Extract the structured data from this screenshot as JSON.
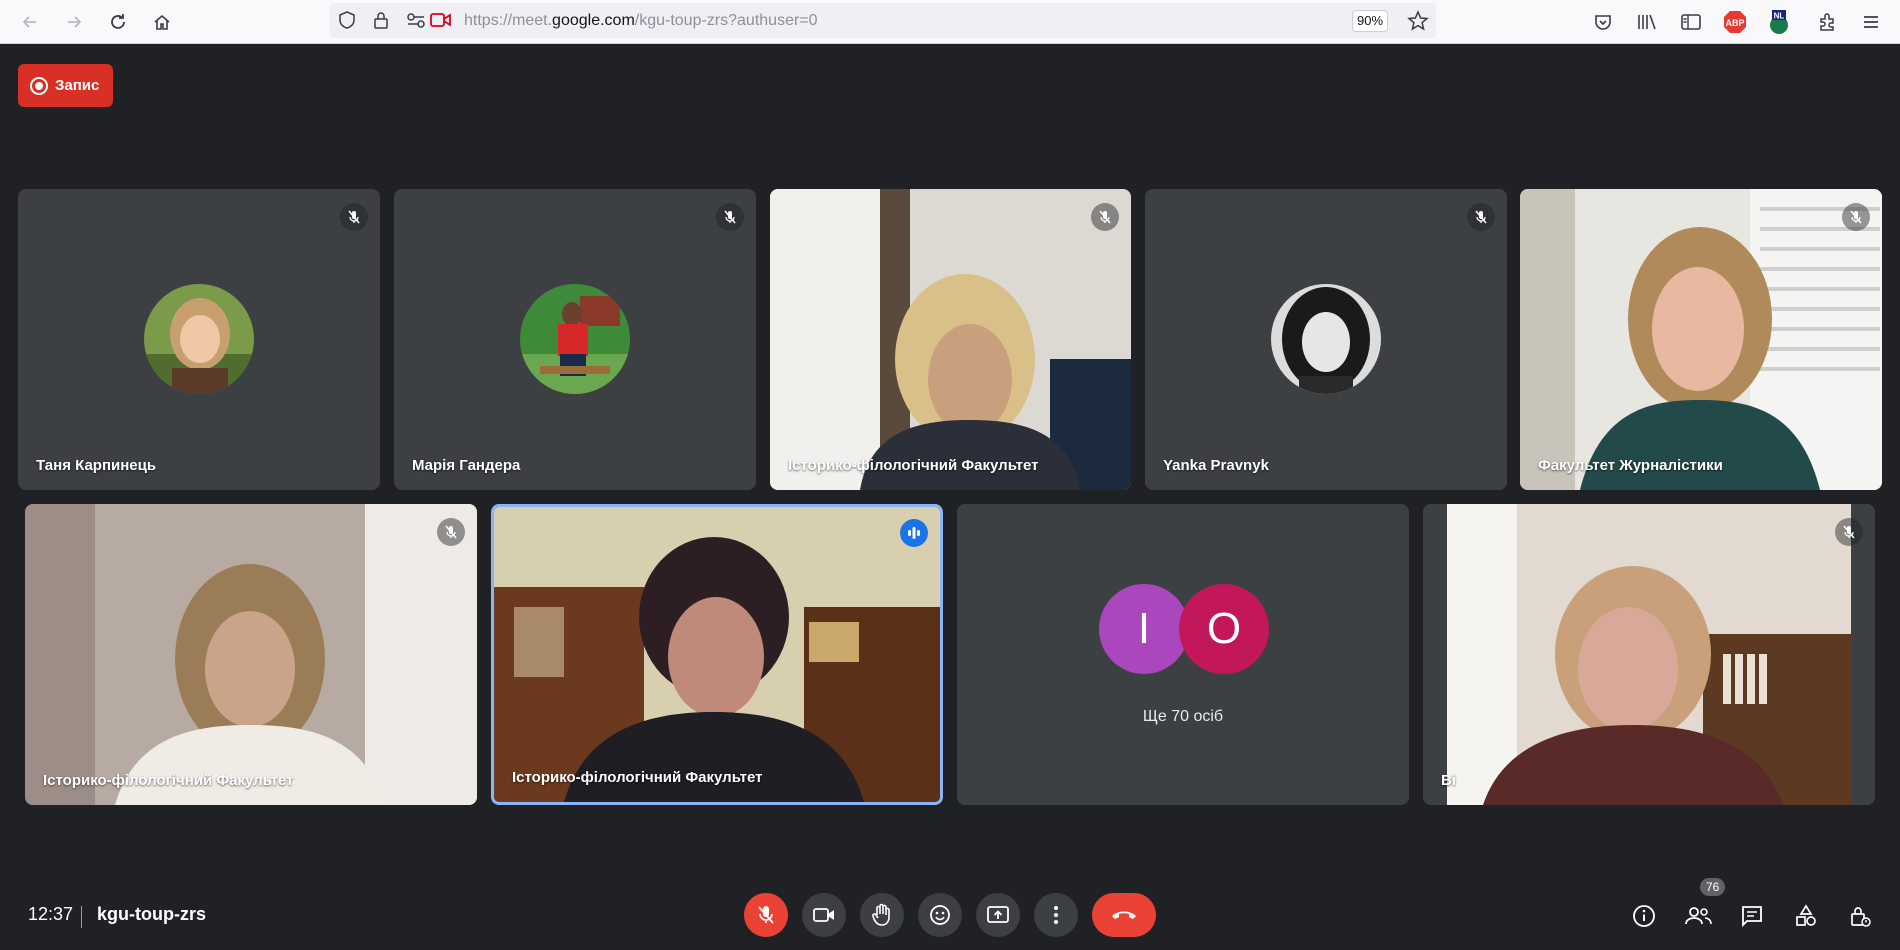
{
  "browser": {
    "url_prefix": "https://meet.",
    "url_host": "google.com",
    "url_path": "/kgu-toup-zrs?authuser=0",
    "zoom": "90%"
  },
  "recording": {
    "label": "Запис"
  },
  "tiles": [
    {
      "name": "Таня Карпинець",
      "muted": true
    },
    {
      "name": "Марія Гандера",
      "muted": true
    },
    {
      "name": "Історико-філологічний Факультет",
      "muted": true
    },
    {
      "name": "Yanka Pravnyk",
      "muted": true
    },
    {
      "name": "Факультет Журналістики",
      "muted": true
    },
    {
      "name": "Історико-філологічний Факультет",
      "muted": true
    },
    {
      "name": "Історико-філологічний Факультет",
      "speaking": true
    },
    {
      "name": "Ві",
      "muted": true
    }
  ],
  "others": {
    "letters": [
      "I",
      "O"
    ],
    "label": "Ще 70 осіб",
    "colors": [
      "#ab47bc",
      "#c2185b"
    ]
  },
  "footer": {
    "time": "12:37",
    "meeting_code": "kgu-toup-zrs",
    "participants_count": "76"
  },
  "colors": {
    "background": "#202124",
    "tile": "#3c4043",
    "recording": "#d93025",
    "leave": "#ea4335",
    "active_border": "#8ab4f8"
  },
  "icons": [
    "back-icon",
    "forward-icon",
    "reload-icon",
    "home-icon",
    "shield-icon",
    "lock-icon",
    "permissions-icon",
    "camera-permission-icon",
    "bookmark-star-icon",
    "pocket-icon",
    "library-icon",
    "sidebar-icon",
    "abp-extension-icon",
    "nl-extension-icon",
    "extensions-icon",
    "menu-icon",
    "mic-off-icon",
    "camera-icon",
    "raise-hand-icon",
    "emoji-icon",
    "present-icon",
    "more-options-icon",
    "end-call-icon",
    "info-icon",
    "people-icon",
    "chat-icon",
    "activities-icon",
    "host-controls-icon"
  ]
}
